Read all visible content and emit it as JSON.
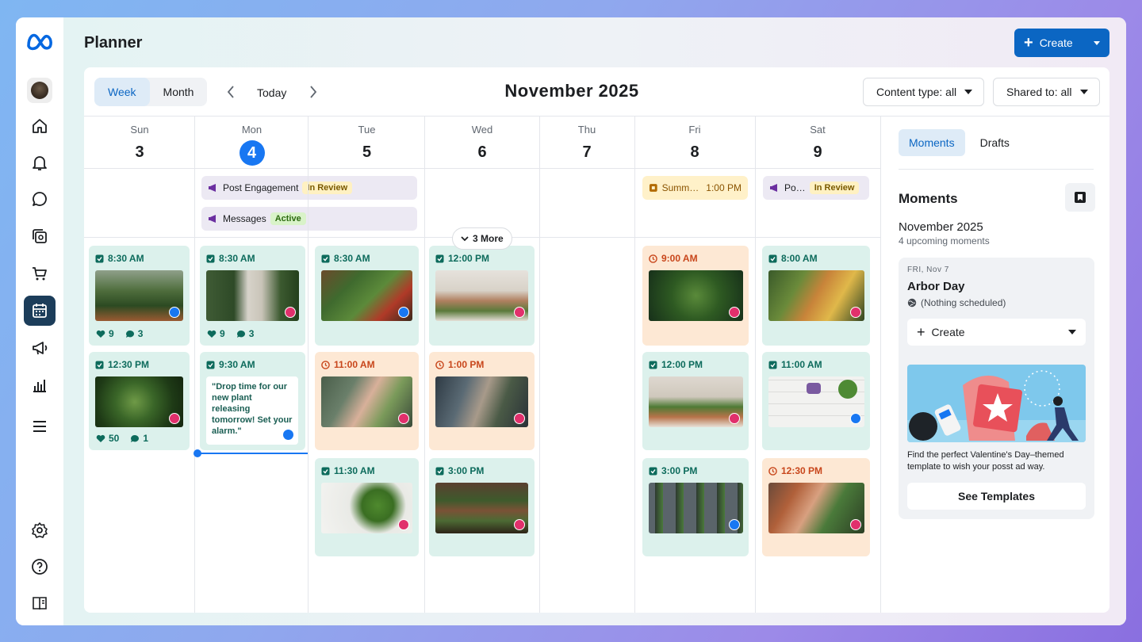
{
  "app": {
    "title": "Planner",
    "create_label": "Create"
  },
  "toolbar": {
    "view_week": "Week",
    "view_month": "Month",
    "today": "Today",
    "month_title": "November 2025",
    "content_type": "Content type: all",
    "shared_to": "Shared to: all"
  },
  "days": [
    {
      "name": "Sun",
      "num": "3"
    },
    {
      "name": "Mon",
      "num": "4"
    },
    {
      "name": "Tue",
      "num": "5"
    },
    {
      "name": "Wed",
      "num": "6"
    },
    {
      "name": "Thu",
      "num": "7"
    },
    {
      "name": "Fri",
      "num": "8"
    },
    {
      "name": "Sat",
      "num": "9"
    }
  ],
  "allday": {
    "post_engagement": "Post Engagement",
    "in_review": "In Review",
    "messages": "Messages",
    "active": "Active",
    "summ": "Summ…",
    "summ_time": "1:00 PM",
    "po": "Po…",
    "in_review_sat": "In Review",
    "more": "3 More"
  },
  "posts": {
    "sun1_time": "8:30 AM",
    "sun1_likes": "9",
    "sun1_comments": "3",
    "sun2_time": "12:30 PM",
    "sun2_likes": "50",
    "sun2_comments": "1",
    "mon1_time": "8:30 AM",
    "mon1_likes": "9",
    "mon1_comments": "3",
    "mon2_time": "9:30 AM",
    "mon2_quote": "\"Drop time for our new plant releasing tomorrow! Set your alarm.\"",
    "tue1_time": "8:30 AM",
    "tue2_time": "11:00 AM",
    "tue3_time": "11:30 AM",
    "wed1_time": "12:00 PM",
    "wed2_time": "1:00 PM",
    "wed3_time": "3:00 PM",
    "fri1_time": "9:00 AM",
    "fri2_time": "12:00 PM",
    "fri3_time": "3:00 PM",
    "sat1_time": "8:00 AM",
    "sat2_time": "11:00 AM",
    "sat3_time": "12:30 PM"
  },
  "side": {
    "tab_moments": "Moments",
    "tab_drafts": "Drafts",
    "heading": "Moments",
    "month": "November 2025",
    "upcoming": "4 upcoming moments",
    "moment_date": "FRI, Nov 7",
    "moment_name": "Arbor Day",
    "moment_status": "(Nothing scheduled)",
    "create": "Create",
    "promo_text": "Find the perfect Valentine's Day–themed template to wish your posst ad way.",
    "see_templates": "See Templates"
  },
  "colors": {
    "accent": "#1877f2",
    "primary_button": "#0b66c3",
    "scheduled_green": "#dcf1ec",
    "pending_orange": "#fde8d4",
    "facebook": "#1877f2",
    "instagram": "#e1306c"
  },
  "icons": [
    "meta-logo-icon",
    "home-icon",
    "bell-icon",
    "chat-icon",
    "posts-icon",
    "shop-icon",
    "calendar-icon",
    "megaphone-icon",
    "insights-icon",
    "menu-icon",
    "settings-icon",
    "help-icon",
    "report-icon"
  ]
}
